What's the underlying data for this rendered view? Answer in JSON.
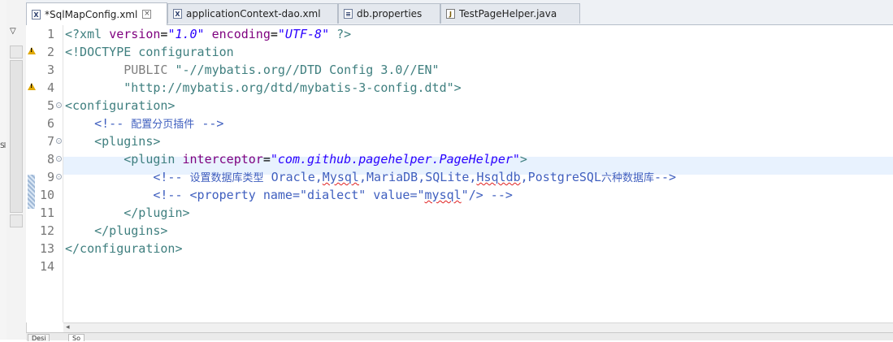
{
  "left_fragment": "Sl",
  "tabs": [
    {
      "label": "*SqlMapConfig.xml",
      "icon": "xml-file-icon",
      "active": true,
      "closable": true
    },
    {
      "label": "applicationContext-dao.xml",
      "icon": "xml-file-icon",
      "active": false
    },
    {
      "label": "db.properties",
      "icon": "properties-file-icon",
      "active": false
    },
    {
      "label": "TestPageHelper.java",
      "icon": "java-file-icon",
      "active": false
    }
  ],
  "line_numbers": [
    "1",
    "2",
    "3",
    "4",
    "5",
    "6",
    "7",
    "8",
    "9",
    "10",
    "11",
    "12",
    "13",
    "14"
  ],
  "code": {
    "l1": {
      "pi_open": "<?xml ",
      "a1": "version",
      "eq1": "=",
      "v1": "\"1.0\"",
      "sp": " ",
      "a2": "encoding",
      "eq2": "=",
      "v2": "\"UTF-8\"",
      "pi_close": " ?>"
    },
    "l2": {
      "text": "<!DOCTYPE configuration"
    },
    "l3": {
      "indent": "        ",
      "kw": "PUBLIC ",
      "str": "\"-//mybatis.org//DTD Config 3.0//EN\""
    },
    "l4": {
      "indent": "        ",
      "str": "\"http://mybatis.org/dtd/mybatis-3-config.dtd\"",
      "close": ">"
    },
    "l5": {
      "tag": "<configuration>"
    },
    "l6": {
      "indent": "    ",
      "open": "<!-- ",
      "cn": "配置分页插件",
      "close": " -->"
    },
    "l7": {
      "indent": "    ",
      "tag": "<plugins>"
    },
    "l8": {
      "indent": "        ",
      "tag_open": "<plugin ",
      "attr": "interceptor",
      "eq": "=",
      "val": "\"com.github.pagehelper.PageHelper\"",
      "tag_close": ">"
    },
    "l9": {
      "indent": "            ",
      "open": "<!-- ",
      "cn": "设置数据库类型",
      "p1": " Oracle,",
      "w1": "Mysql",
      "p2": ",MariaDB,SQLite,",
      "w2": "Hsqldb",
      "p3": ",PostgreSQL",
      "cn2": "六种数据库",
      "close": "-->"
    },
    "l10": {
      "indent": "            ",
      "p1": "<!-- <property name=\"dialect\" value=\"",
      "w1": "mysql",
      "p2": "\"/> -->"
    },
    "l11": {
      "indent": "        ",
      "tag": "</plugin>"
    },
    "l12": {
      "indent": "    ",
      "tag": "</plugins>"
    },
    "l13": {
      "tag": "</configuration>"
    }
  },
  "bottom_tabs": [
    "Desi",
    "So"
  ],
  "colors": {
    "current_line": "#e8f2fe",
    "attribute": "#7f007f",
    "value": "#2a00ff",
    "tag": "#3f7f7f",
    "comment": "#3f5fbf",
    "warning": "#e0a800"
  }
}
